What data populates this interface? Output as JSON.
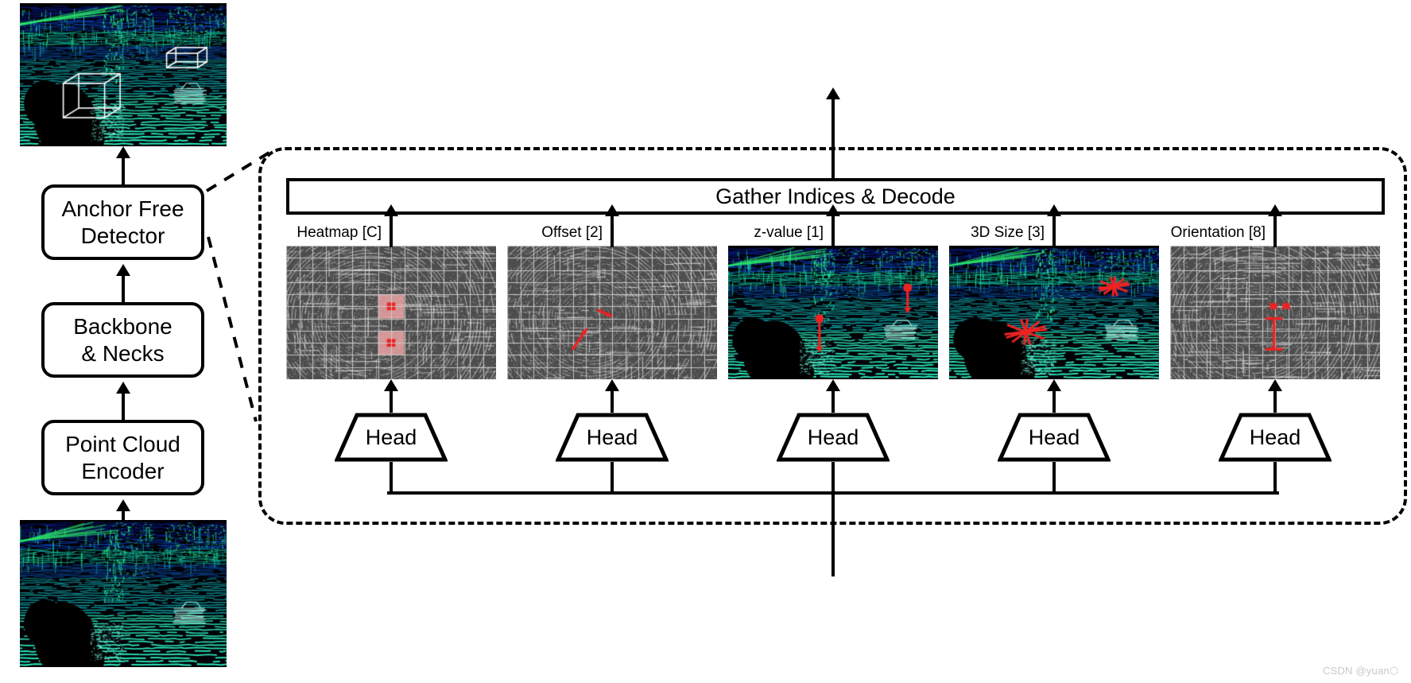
{
  "pipeline": {
    "boxes": [
      {
        "id": "anchor-free-detector",
        "label": "Anchor Free\nDetector"
      },
      {
        "id": "backbone-necks",
        "label": "Backbone\n& Necks"
      },
      {
        "id": "point-cloud-encoder",
        "label": "Point Cloud\nEncoder"
      }
    ],
    "top_image_caption": "",
    "bottom_image_caption": ""
  },
  "detector": {
    "gather_bar_label": "Gather Indices & Decode",
    "branches": [
      {
        "id": "heatmap",
        "label": "Heatmap [C]",
        "head_label": "Head",
        "map_type": "bev-grid-heatmap"
      },
      {
        "id": "offset",
        "label": "Offset [2]",
        "head_label": "Head",
        "map_type": "bev-grid-offset"
      },
      {
        "id": "z-value",
        "label": "z-value [1]",
        "head_label": "Head",
        "map_type": "perspective-zvalue"
      },
      {
        "id": "3d-size",
        "label": "3D Size [3]",
        "head_label": "Head",
        "map_type": "perspective-size"
      },
      {
        "id": "orientation",
        "label": "Orientation [8]",
        "head_label": "Head",
        "map_type": "bev-grid-orientation"
      }
    ]
  },
  "colors": {
    "accent_red": "#ee2222",
    "heatmap_fill": "#f4a8a8",
    "grid_line": "#c8c8c8",
    "map_bg": "#4d4d4d",
    "stroke": "#000000",
    "watermark": "#c9c9c9"
  },
  "watermark": {
    "text": "CSDN @yuan⬡"
  }
}
